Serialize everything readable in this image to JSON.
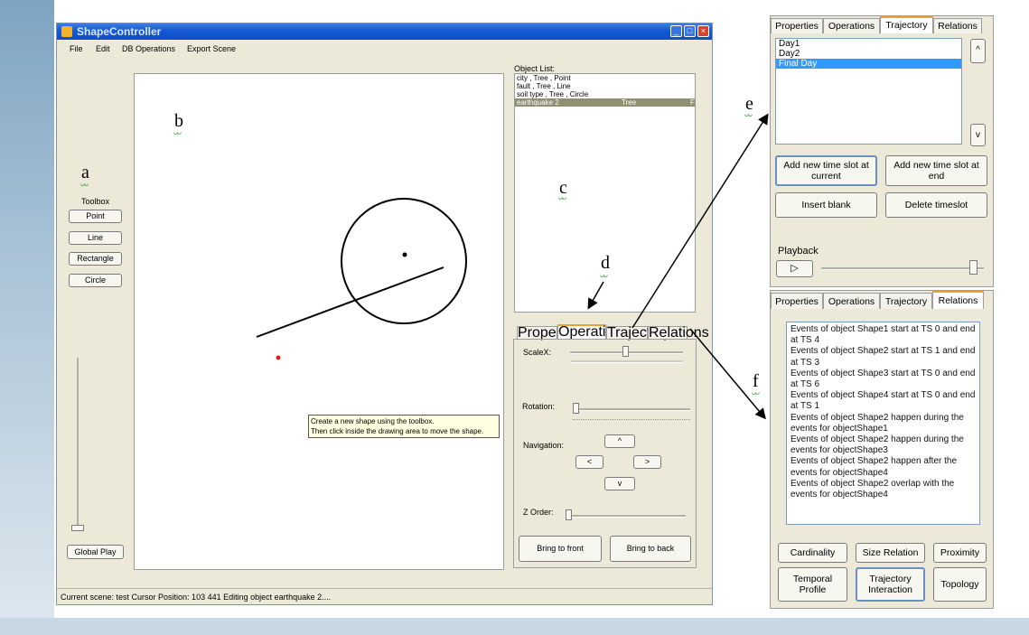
{
  "window": {
    "title": "ShapeController",
    "menu": [
      "File",
      "Edit",
      "DB Operations",
      "Export Scene"
    ]
  },
  "toolbox": {
    "label": "Toolbox",
    "buttons": [
      "Point",
      "Line",
      "Rectangle",
      "Circle"
    ],
    "global_play": "Global Play"
  },
  "object_list": {
    "label": "Object List:",
    "items": [
      {
        "text": "city , Tree , Point",
        "selected": false
      },
      {
        "text": "fault , Tree , Line",
        "selected": false
      },
      {
        "text": "soil type , Tree , Circle",
        "selected": false
      },
      {
        "text": "earthquake 2",
        "col2": "Tree",
        "col3": "F",
        "selected": true
      }
    ]
  },
  "ops_panel": {
    "tabs": [
      "Properties",
      "Operations",
      "Trajectory",
      "Relations"
    ],
    "active_tab": "Operations",
    "scalex_label": "ScaleX:",
    "rotation_label": "Rotation:",
    "navigation_label": "Navigation:",
    "nav_up": "^",
    "nav_left": "<",
    "nav_right": ">",
    "nav_down": "v",
    "zorder_label": "Z Order:",
    "bring_front": "Bring to front",
    "bring_back": "Bring to back"
  },
  "tooltip": {
    "line1": "Create a new shape using the toolbox.",
    "line2": "Then click inside the drawing area to move the shape."
  },
  "status": {
    "text": "Current scene:  test  Cursor Position:  103 441  Editing object earthquake 2...."
  },
  "annotations": [
    "a",
    "b",
    "c",
    "d",
    "e",
    "f"
  ],
  "trajectory_panel": {
    "tabs": [
      "Properties",
      "Operations",
      "Trajectory",
      "Relations"
    ],
    "active_tab": "Trajectory",
    "days": [
      {
        "text": "Day1",
        "selected": false
      },
      {
        "text": "Day2",
        "selected": false
      },
      {
        "text": "Final Day",
        "selected": true
      }
    ],
    "scroll_up": "^",
    "scroll_down": "v",
    "add_current": "Add new time slot at current",
    "add_end": "Add new time slot at end",
    "insert_blank": "Insert blank",
    "delete_timeslot": "Delete timeslot",
    "playback_label": "Playback",
    "play_icon": "▷"
  },
  "relations_panel": {
    "tabs": [
      "Properties",
      "Operations",
      "Trajectory",
      "Relations"
    ],
    "active_tab": "Relations",
    "events": [
      "Events of object Shape1 start at TS 0 and end at TS 4",
      "Events of object Shape2 start at TS 1 and end at TS 3",
      "Events of object Shape3 start at TS 0 and end at TS 6",
      "Events of object Shape4 start at TS 0 and end at TS 1",
      "Events of object Shape2 happen during the events for objectShape1",
      "Events of object Shape2 happen during the events for objectShape3",
      "Events of object Shape2 happen after the events for objectShape4",
      "Events of object Shape2 overlap with the events for objectShape4"
    ],
    "buttons_row1": [
      "Cardinality",
      "Size Relation",
      "Proximity"
    ],
    "buttons_row2": [
      "Temporal Profile",
      "Trajectory Interaction",
      "Topology"
    ]
  },
  "colors": {
    "titlebar": "#1459d5",
    "window_bg": "#ece9d8",
    "selection": "#3399ff",
    "active_tab_accent": "#e8a23a",
    "red_point": "#e02020"
  }
}
